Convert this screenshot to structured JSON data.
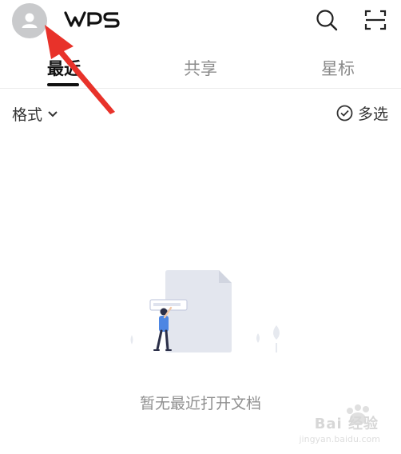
{
  "header": {
    "logo_text": "WPS",
    "avatar_icon": "user-avatar-icon",
    "search_icon": "search-icon",
    "scan_icon": "scan-icon"
  },
  "tabs": [
    {
      "label": "最近",
      "active": true
    },
    {
      "label": "共享",
      "active": false
    },
    {
      "label": "星标",
      "active": false
    }
  ],
  "filters": {
    "format_label": "格式",
    "multi_select_label": "多选"
  },
  "empty_state": {
    "message": "暂无最近打开文档"
  },
  "watermark": {
    "brand": "Bai 经验",
    "url": "jingyan.baidu.com"
  },
  "colors": {
    "accent": "#111111",
    "muted_text": "#8f8f8f",
    "annotation_arrow": "#e8322a",
    "doc_gray": "#e3e6ee"
  }
}
